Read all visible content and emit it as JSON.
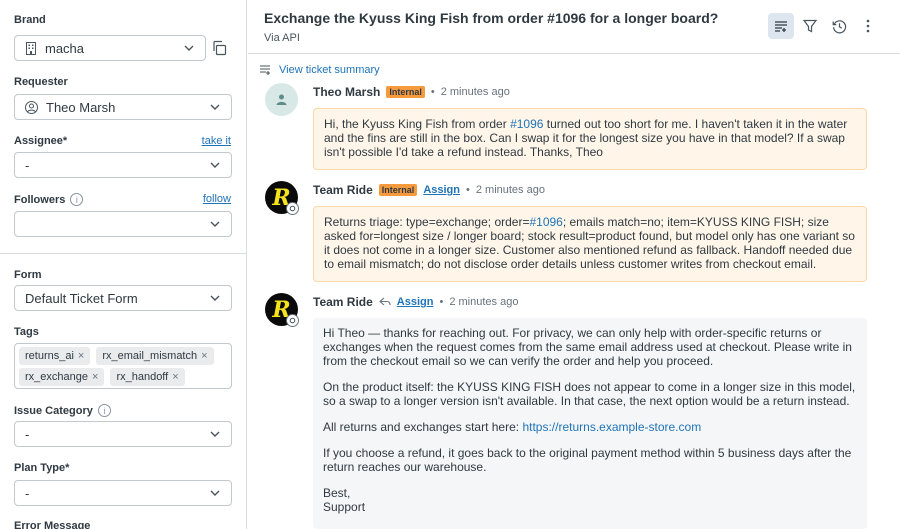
{
  "sidebar": {
    "brand": {
      "label": "Brand",
      "value": "macha"
    },
    "requester": {
      "label": "Requester",
      "value": "Theo Marsh"
    },
    "assignee": {
      "label": "Assignee*",
      "link": "take it",
      "value": "-"
    },
    "followers": {
      "label": "Followers",
      "link": "follow",
      "value": ""
    },
    "form": {
      "label": "Form",
      "value": "Default Ticket Form"
    },
    "tags": {
      "label": "Tags",
      "items": [
        "returns_ai",
        "rx_email_mismatch",
        "rx_exchange",
        "rx_handoff"
      ],
      "remove_glyph": "×"
    },
    "issue_category": {
      "label": "Issue Category",
      "value": "-"
    },
    "plan_type": {
      "label": "Plan Type*",
      "value": "-"
    },
    "error_message": {
      "label": "Error Message"
    },
    "info_glyph": "i"
  },
  "header": {
    "title": "Exchange the Kyuss King Fish from order #1096 for a longer board?",
    "via": "Via API",
    "icons": [
      "summary-icon",
      "filter-icon",
      "history-icon",
      "more-icon"
    ]
  },
  "summary_link": "View ticket summary",
  "messages": [
    {
      "author": "Theo Marsh",
      "badge": "Internal",
      "sep": "•",
      "time": "2 minutes ago",
      "text_pre": "Hi, the Kyuss King Fish from order ",
      "order_link": "#1096",
      "text_post": " turned out too short for me. I haven't taken it in the water and the fins are still in the box. Can I swap it for the longest size you have in that model? If a swap isn't possible I'd take a refund instead. Thanks, Theo"
    },
    {
      "author": "Team Ride",
      "badge": "Internal",
      "assign": "Assign",
      "sep": "•",
      "time": "2 minutes ago",
      "text_pre": "Returns triage: type=exchange; order=",
      "order_link": "#1096",
      "text_post": "; emails match=no; item=KYUSS KING FISH; size asked for=longest size / longer board; stock result=product found, but model only has one variant so it does not come in a longer size. Customer also mentioned refund as fallback. Handoff needed due to email mismatch; do not disclose order details unless customer writes from checkout email."
    },
    {
      "author": "Team Ride",
      "assign": "Assign",
      "sep": "•",
      "time": "2 minutes ago",
      "paragraphs": [
        "Hi Theo — thanks for reaching out. For privacy, we can only help with order-specific returns or exchanges when the request comes from the same email address used at checkout. Please write in from the checkout email so we can verify the order and help you proceed.",
        "On the product itself: the KYUSS KING FISH does not appear to come in a longer size in this model, so a swap to a longer version isn't available. In that case, the next option would be a return instead."
      ],
      "returns_pre": "All returns and exchanges start here: ",
      "returns_link": "https://returns.example-store.com",
      "paragraph_after": "If you choose a refund, it goes back to the original payment method within 5 business days after the return reaches our warehouse.",
      "signoff": "Best,",
      "signature": "Support"
    }
  ],
  "avatar_letter": "R",
  "colors": {
    "accent": "#1f73b7",
    "internal": "#f79a3e",
    "note_bg": "#fff6e9",
    "logo_yellow": "#f4e21a"
  }
}
